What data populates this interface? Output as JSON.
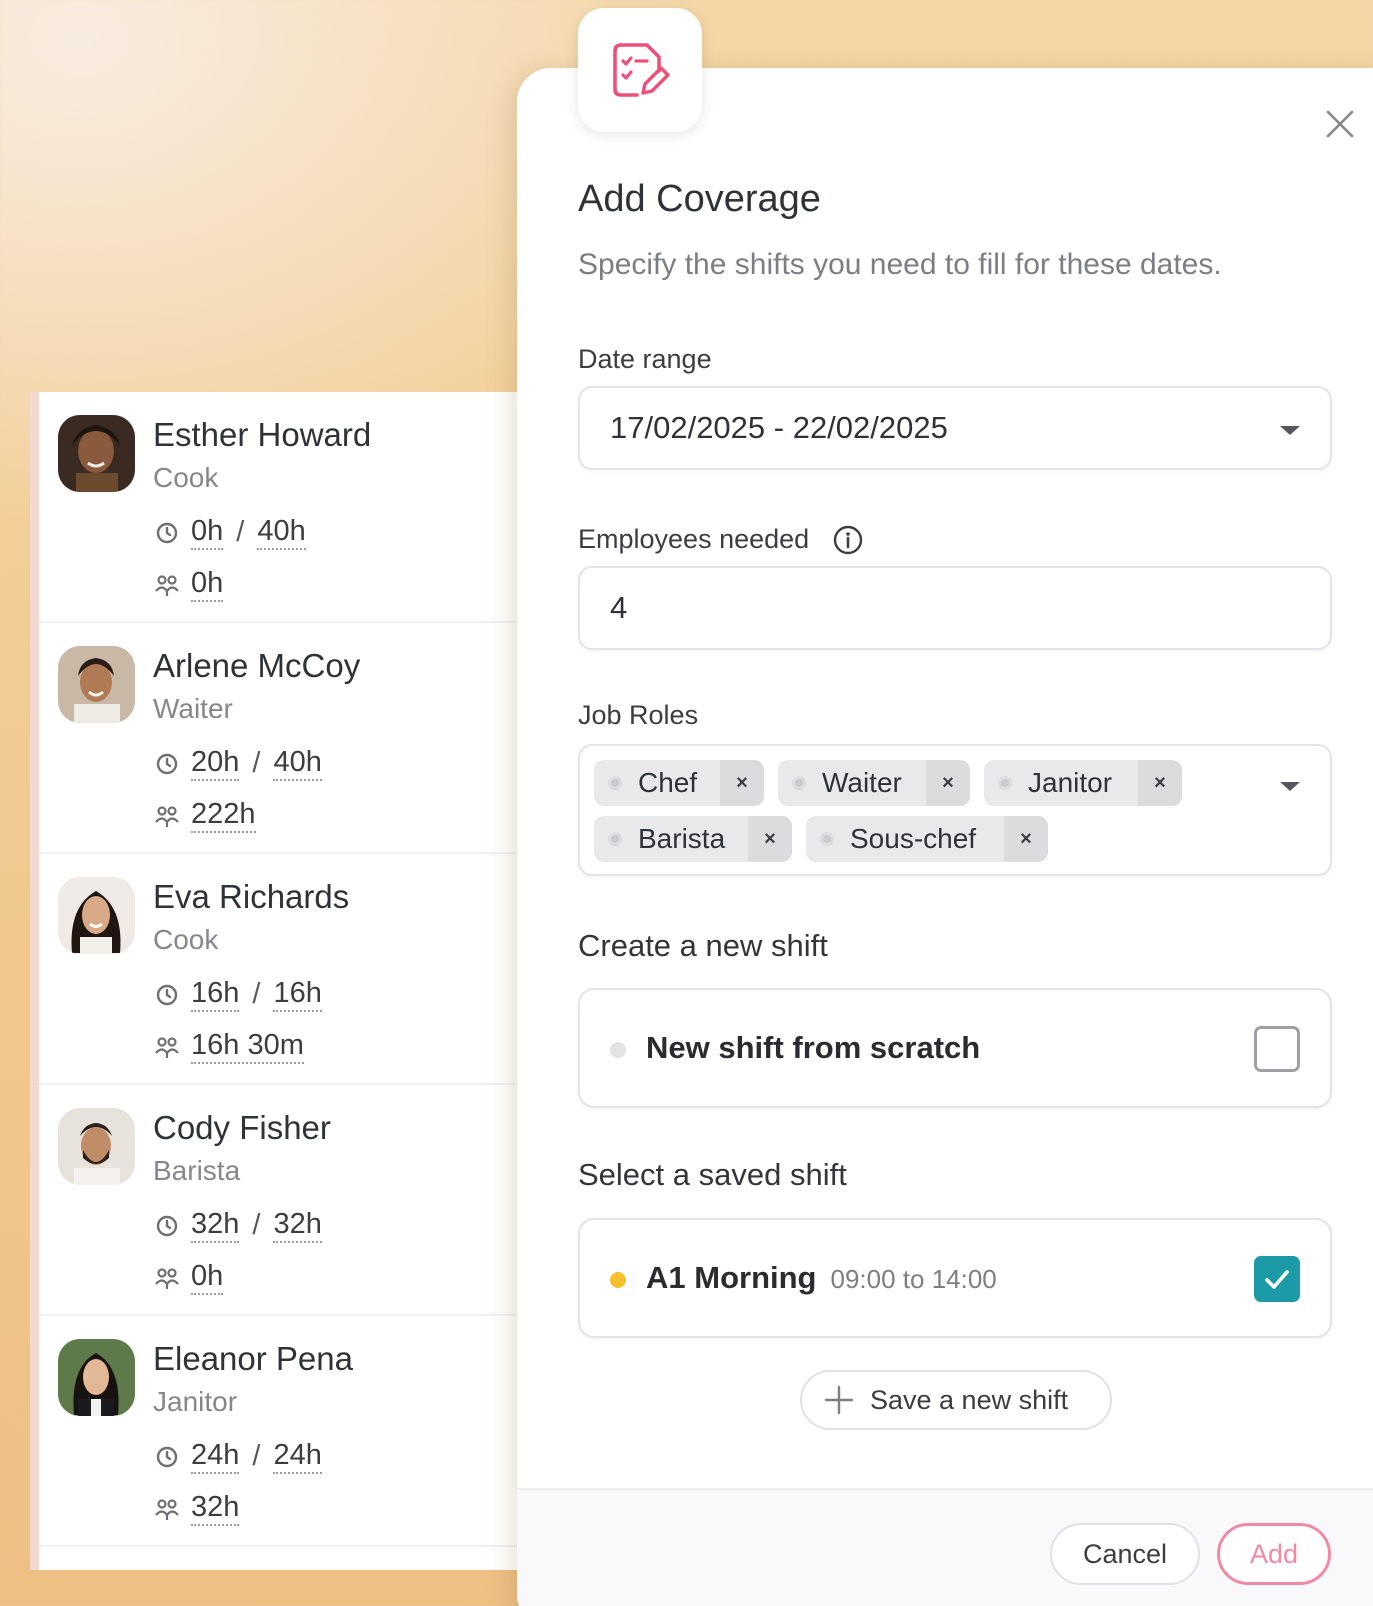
{
  "employees": [
    {
      "name": "Esther Howard",
      "role": "Cook",
      "hours_worked": "0h",
      "hours_total": "40h",
      "team_hours": "0h",
      "avatar": "avatar-esther"
    },
    {
      "name": "Arlene McCoy",
      "role": "Waiter",
      "hours_worked": "20h",
      "hours_total": "40h",
      "team_hours": "222h",
      "avatar": "avatar-arlene"
    },
    {
      "name": "Eva Richards",
      "role": "Cook",
      "hours_worked": "16h",
      "hours_total": "16h",
      "team_hours": "16h 30m",
      "avatar": "avatar-eva"
    },
    {
      "name": "Cody Fisher",
      "role": "Barista",
      "hours_worked": "32h",
      "hours_total": "32h",
      "team_hours": "0h",
      "avatar": "avatar-cody"
    },
    {
      "name": "Eleanor Pena",
      "role": "Janitor",
      "hours_worked": "24h",
      "hours_total": "24h",
      "team_hours": "32h",
      "avatar": "avatar-eleanor"
    }
  ],
  "stat_separator": "/",
  "modal": {
    "header_icon": "document-edit-icon",
    "title": "Add Coverage",
    "subtitle": "Specify the shifts you need to fill for these dates.",
    "date_range": {
      "label": "Date range",
      "value": "17/02/2025 - 22/02/2025"
    },
    "employees_needed": {
      "label": "Employees needed",
      "value": "4"
    },
    "job_roles": {
      "label": "Job Roles",
      "selected": [
        "Chef",
        "Waiter",
        "Janitor",
        "Barista",
        "Sous-chef"
      ],
      "remove_glyph": "×"
    },
    "new_shift": {
      "label": "Create a new shift",
      "option": "New shift from scratch",
      "checked": false,
      "dot_color": "#e3e3e6"
    },
    "saved_shift": {
      "label": "Select a saved shift",
      "name": "A1 Morning",
      "time": "09:00 to 14:00",
      "checked": true,
      "dot_color": "#f7c02e"
    },
    "save_new_shift_label": "Save a new shift",
    "cancel_label": "Cancel",
    "add_label": "Add"
  },
  "colors": {
    "accent_pink": "#f08aa4",
    "check_teal": "#1c9aa6",
    "background_peach": "#f0c88d"
  }
}
